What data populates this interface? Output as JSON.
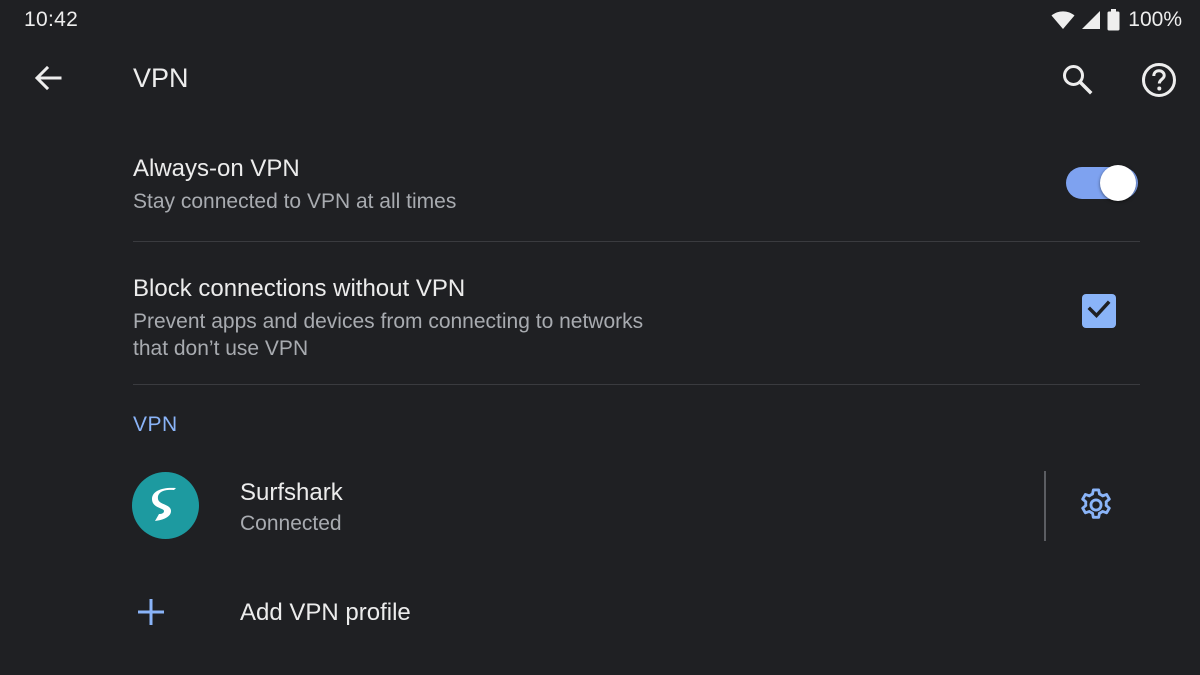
{
  "status_bar": {
    "time": "10:42",
    "battery": "100%",
    "icons": [
      "wifi-icon",
      "cell-signal-icon",
      "battery-icon"
    ]
  },
  "app_bar": {
    "title": "VPN",
    "icons": [
      "back-arrow-icon",
      "search-icon",
      "help-icon"
    ]
  },
  "always_on": {
    "title": "Always-on VPN",
    "subtitle": "Stay connected to VPN at all times",
    "enabled": true
  },
  "block_connections": {
    "title": "Block connections without VPN",
    "subtitle_line1": "Prevent apps and devices from connecting to networks",
    "subtitle_line2": "that don’t use VPN",
    "checked": true
  },
  "vpn_section": {
    "header": "VPN",
    "items": [
      {
        "name": "Surfshark",
        "status": "Connected",
        "icon": "surfshark-logo-icon",
        "settings_icon": "gear-icon"
      }
    ],
    "add_label": "Add VPN profile",
    "add_icon": "plus-icon"
  },
  "colors": {
    "background": "#1f2023",
    "accent": "#8ab4f8",
    "toggle_track": "#7ea2f0",
    "surfshark_teal": "#1d9aa0",
    "divider": "#3a3b3f"
  }
}
